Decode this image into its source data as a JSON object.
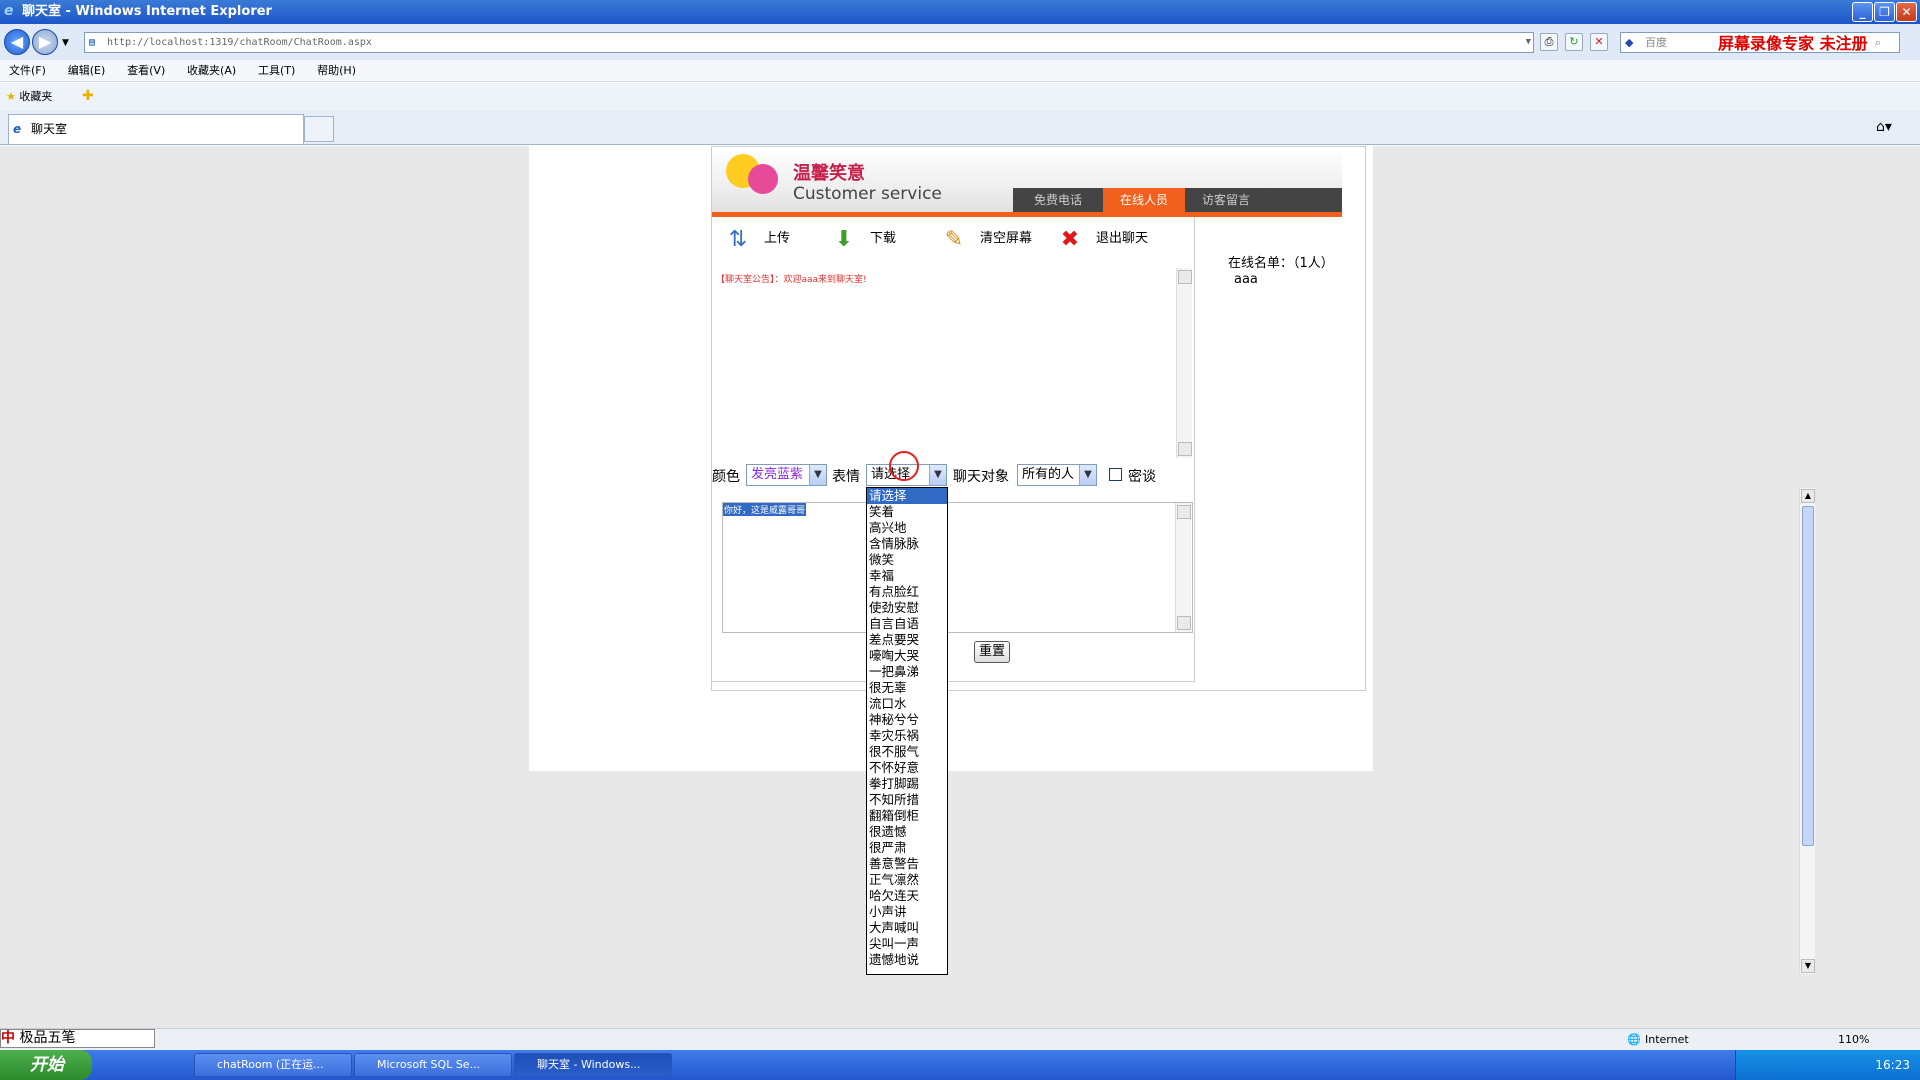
{
  "window": {
    "title": "聊天室 - Windows Internet Explorer"
  },
  "browser": {
    "address": "http://localhost:1319/chatRoom/ChatRoom.aspx",
    "address_host": "localhost",
    "search_placeholder": "百度",
    "recorder_watermark": "屏幕录像专家  未注册",
    "menu": [
      "文件(F)",
      "编辑(E)",
      "查看(V)",
      "收藏夹(A)",
      "工具(T)",
      "帮助(H)"
    ],
    "favorites_label": "收藏夹",
    "tab_title": "聊天室"
  },
  "chat": {
    "brand_cn": "温馨笑意",
    "brand_en": "Customer service",
    "nav": [
      "免费电话",
      "在线人员",
      "访客留言"
    ],
    "tools": [
      "上传",
      "下载",
      "清空屏幕",
      "退出聊天"
    ],
    "notice": "【聊天室公告】：欢迎aaa来到聊天室!",
    "online_label": "在线名单：（1人）",
    "online_users": [
      "aaa"
    ],
    "color_label": "颜色",
    "color_value": "发亮蓝紫",
    "emotion_label": "表情",
    "emotion_value": "请选择",
    "target_label": "聊天对象",
    "target_value": "所有的人",
    "private_label": "密谈",
    "input_text": "你好，这是威露哥哥",
    "reset_label": "重置",
    "emotion_options": [
      "请选择",
      "笑着",
      "高兴地",
      "含情脉脉",
      "微笑",
      "幸福",
      "有点脸红",
      "使劲安慰",
      "自言自语",
      "差点要哭",
      "嚎啕大哭",
      "一把鼻涕",
      "很无辜",
      "流口水",
      "神秘兮兮",
      "幸灾乐祸",
      "很不服气",
      "不怀好意",
      "拳打脚踢",
      "不知所措",
      "翻箱倒柜",
      "很遗憾",
      "很严肃",
      "善意警告",
      "正气凛然",
      "哈欠连天",
      "小声讲",
      "大声喊叫",
      "尖叫一声",
      "遗憾地说"
    ]
  },
  "status": {
    "zone": "Internet",
    "zoom": "110%",
    "ime": "极品五笔"
  },
  "taskbar": {
    "start": "开始",
    "tasks": [
      "chatRoom (正在运...",
      "Microsoft SQL Se...",
      "聊天室 - Windows..."
    ],
    "clock": "16:23"
  }
}
